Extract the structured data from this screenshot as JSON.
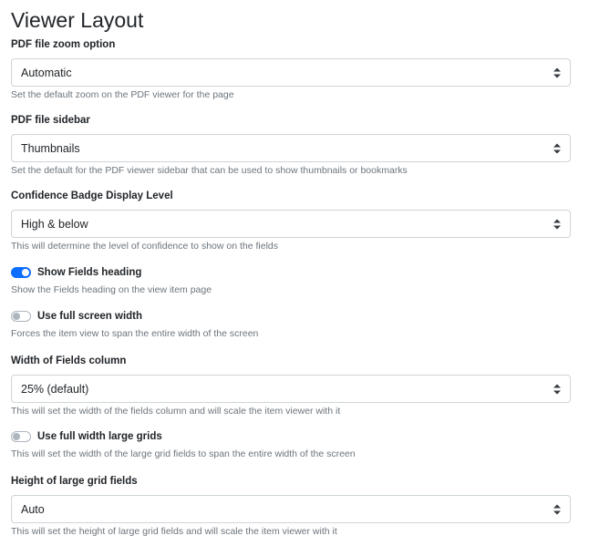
{
  "page": {
    "title": "Viewer Layout"
  },
  "zoom": {
    "label": "PDF file zoom option",
    "value": "Automatic",
    "help": "Set the default zoom on the PDF viewer for the page"
  },
  "sidebar": {
    "label": "PDF file sidebar",
    "value": "Thumbnails",
    "help": "Set the default for the PDF viewer sidebar that can be used to show thumbnails or bookmarks"
  },
  "confidence": {
    "label": "Confidence Badge Display Level",
    "value": "High & below",
    "help": "This will determine the level of confidence to show on the fields"
  },
  "show_fields_heading": {
    "label": "Show Fields heading",
    "checked": true,
    "help": "Show the Fields heading on the view item page"
  },
  "full_screen_width": {
    "label": "Use full screen width",
    "checked": false,
    "help": "Forces the item view to span the entire width of the screen"
  },
  "fields_column_width": {
    "label": "Width of Fields column",
    "value": "25% (default)",
    "help": "This will set the width of the fields column and will scale the item viewer with it"
  },
  "full_width_large_grids": {
    "label": "Use full width large grids",
    "checked": false,
    "help": "This will set the width of the large grid fields to span the entire width of the screen"
  },
  "large_grid_height": {
    "label": "Height of large grid fields",
    "value": "Auto",
    "help": "This will set the height of large grid fields and will scale the item viewer with it"
  },
  "colors": {
    "accent": "#0d6efd",
    "text": "#212529",
    "muted": "#6c757d",
    "border": "#ced4da",
    "switch_off": "#adb5bd"
  },
  "icons": {
    "select_caret": "select-caret-icon"
  }
}
